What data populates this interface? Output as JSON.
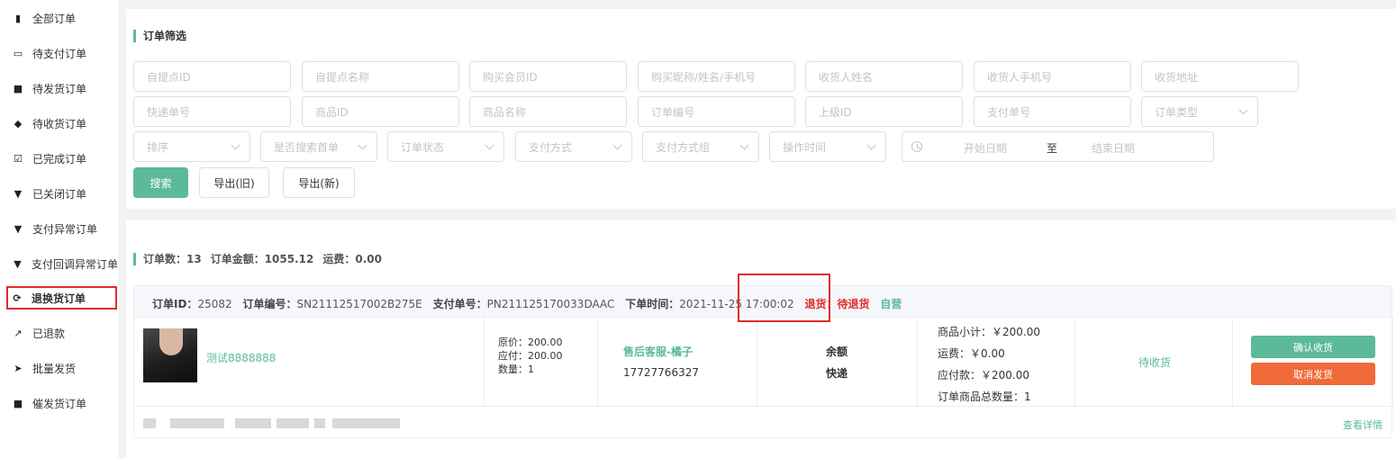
{
  "sidebar": {
    "items": [
      {
        "label": "全部订单",
        "icon": "document-icon"
      },
      {
        "label": "待支付订单",
        "icon": "card-icon"
      },
      {
        "label": "待发货订单",
        "icon": "truck-icon"
      },
      {
        "label": "待收货订单",
        "icon": "package-icon"
      },
      {
        "label": "已完成订单",
        "icon": "checkbox-icon"
      },
      {
        "label": "已关闭订单",
        "icon": "shield-icon"
      },
      {
        "label": "支付异常订单",
        "icon": "shield-icon"
      },
      {
        "label": "支付回调异常订单",
        "icon": "shield-icon"
      },
      {
        "label": "退换货订单",
        "icon": "refresh-icon"
      },
      {
        "label": "已退款",
        "icon": "share-icon"
      },
      {
        "label": "批量发货",
        "icon": "send-icon"
      },
      {
        "label": "催发货订单",
        "icon": "truck-icon"
      }
    ]
  },
  "filter": {
    "title": "订单筛选",
    "row1": [
      "自提点ID",
      "自提点名称",
      "购买会员ID",
      "购买昵称/姓名/手机号",
      "收货人姓名",
      "收货人手机号",
      "收货地址"
    ],
    "row2": [
      "快递单号",
      "商品ID",
      "商品名称",
      "订单编号",
      "上级ID",
      "支付单号"
    ],
    "order_type": "订单类型",
    "selects": [
      "排序",
      "是否搜索首单",
      "订单状态",
      "支付方式",
      "支付方式组",
      "操作时间"
    ],
    "date_start": "开始日期",
    "date_sep": "至",
    "date_end": "结束日期",
    "search_label": "搜索",
    "export_old_label": "导出(旧)",
    "export_new_label": "导出(新)"
  },
  "summary": {
    "order_count": "订单数：13",
    "order_amount": "订单金额：1055.12",
    "shipping": "运费：0.00"
  },
  "order": {
    "id_label": "订单ID：",
    "id": "25082",
    "no_label": "订单编号：",
    "no": "SN21112517002B275E",
    "pay_label": "支付单号：",
    "pay_no": "PN211125170033DAAC",
    "time_label": "下单时间：",
    "time": "2021-11-25 17:00:02",
    "return_status": "退货：待退货",
    "self_tag": "自营",
    "product_name": "测试8888888",
    "original_price": "原价：200.00",
    "payable": "应付：200.00",
    "quantity": "数量：1",
    "service_name": "售后客服-橘子",
    "service_phone": "17727766327",
    "pay_method": "余额",
    "ship_method": "快递",
    "subtotal": "商品小计：￥200.00",
    "freight": "运费：￥0.00",
    "amount_due": "应付款：￥200.00",
    "total_qty": "订单商品总数量：1",
    "status": "待收货",
    "confirm_label": "确认收货",
    "cancel_label": "取消发货",
    "detail_label": "查看详情"
  },
  "colors": {
    "accent": "#5cb99a",
    "danger": "#e12b2b",
    "orange": "#ef6b39"
  }
}
